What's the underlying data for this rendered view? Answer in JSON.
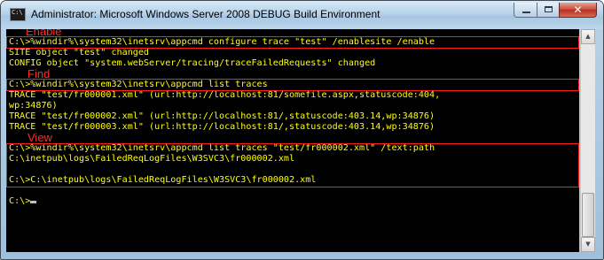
{
  "window": {
    "title": "Administrator:  Microsoft Windows Server 2008 DEBUG Build Environment",
    "icon": "console-icon",
    "icon_glyph": "C:\\",
    "controls": {
      "minimize": "minimize-icon",
      "maximize": "maximize-icon",
      "close": "close-icon",
      "close_glyph": "✕"
    }
  },
  "console": {
    "background": "#000000",
    "text_color": "#ffff00",
    "lines": [
      "C:\\>%windir%\\system32\\inetsrv\\appcmd configure trace \"test\" /enablesite /enable",
      "SITE object \"test\" changed",
      "CONFIG object \"system.webServer/tracing/traceFailedRequests\" changed",
      "",
      "C:\\>%windir%\\system32\\inetsrv\\appcmd list traces",
      "TRACE \"test/fr000001.xml\" (url:http://localhost:81/somefile.aspx,statuscode:404,",
      "wp:34876)",
      "TRACE \"test/fr000002.xml\" (url:http://localhost:81/,statuscode:403.14,wp:34876)",
      "TRACE \"test/fr000003.xml\" (url:http://localhost:81/,statuscode:403.14,wp:34876)",
      "",
      "C:\\>%windir%\\system32\\inetsrv\\appcmd list traces \"test/fr000002.xml\" /text:path",
      "C:\\inetpub\\logs\\FailedReqLogFiles\\W3SVC3\\fr000002.xml",
      "",
      "C:\\>C:\\inetpub\\logs\\FailedReqLogFiles\\W3SVC3\\fr000002.xml",
      "",
      "",
      "C:\\>"
    ]
  },
  "annotations": {
    "color": "#ff2a2a",
    "enable": "Enable",
    "find": "Find",
    "view": "View"
  },
  "scrollbar": {
    "up": "up-arrow-icon",
    "down": "down-arrow-icon",
    "up_glyph": "▲",
    "down_glyph": "▼"
  }
}
